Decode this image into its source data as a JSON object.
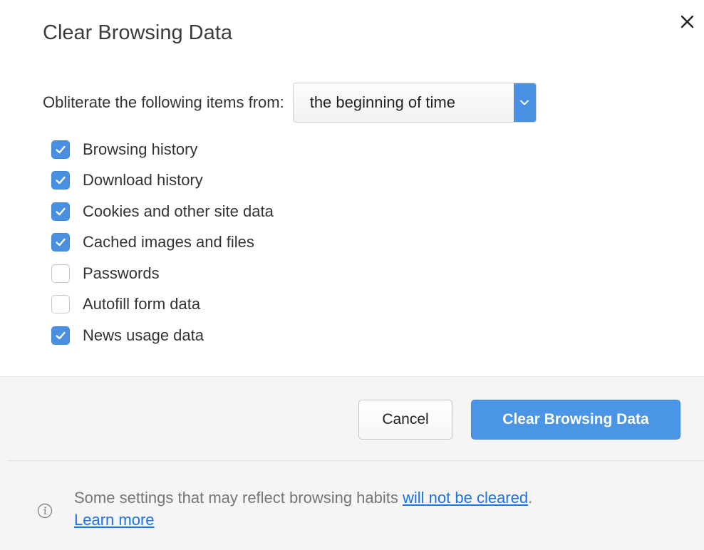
{
  "dialog": {
    "title": "Clear Browsing Data",
    "close_icon": "close-icon"
  },
  "range": {
    "label": "Obliterate the following items from:",
    "selected": "the beginning of time",
    "arrow_icon": "chevron-down-icon"
  },
  "options": [
    {
      "label": "Browsing history",
      "checked": true
    },
    {
      "label": "Download history",
      "checked": true
    },
    {
      "label": "Cookies and other site data",
      "checked": true
    },
    {
      "label": "Cached images and files",
      "checked": true
    },
    {
      "label": "Passwords",
      "checked": false
    },
    {
      "label": "Autofill form data",
      "checked": false
    },
    {
      "label": "News usage data",
      "checked": true
    }
  ],
  "buttons": {
    "cancel": "Cancel",
    "confirm": "Clear Browsing Data"
  },
  "notice": {
    "text_before": "Some settings that may reflect browsing habits ",
    "link_not_cleared": "will not be cleared",
    "text_after": ".",
    "link_learn_more": "Learn more",
    "icon": "info-icon"
  },
  "colors": {
    "accent": "#4a90e2",
    "footer_bg": "#f5f5f5",
    "link": "#1a73e8"
  }
}
